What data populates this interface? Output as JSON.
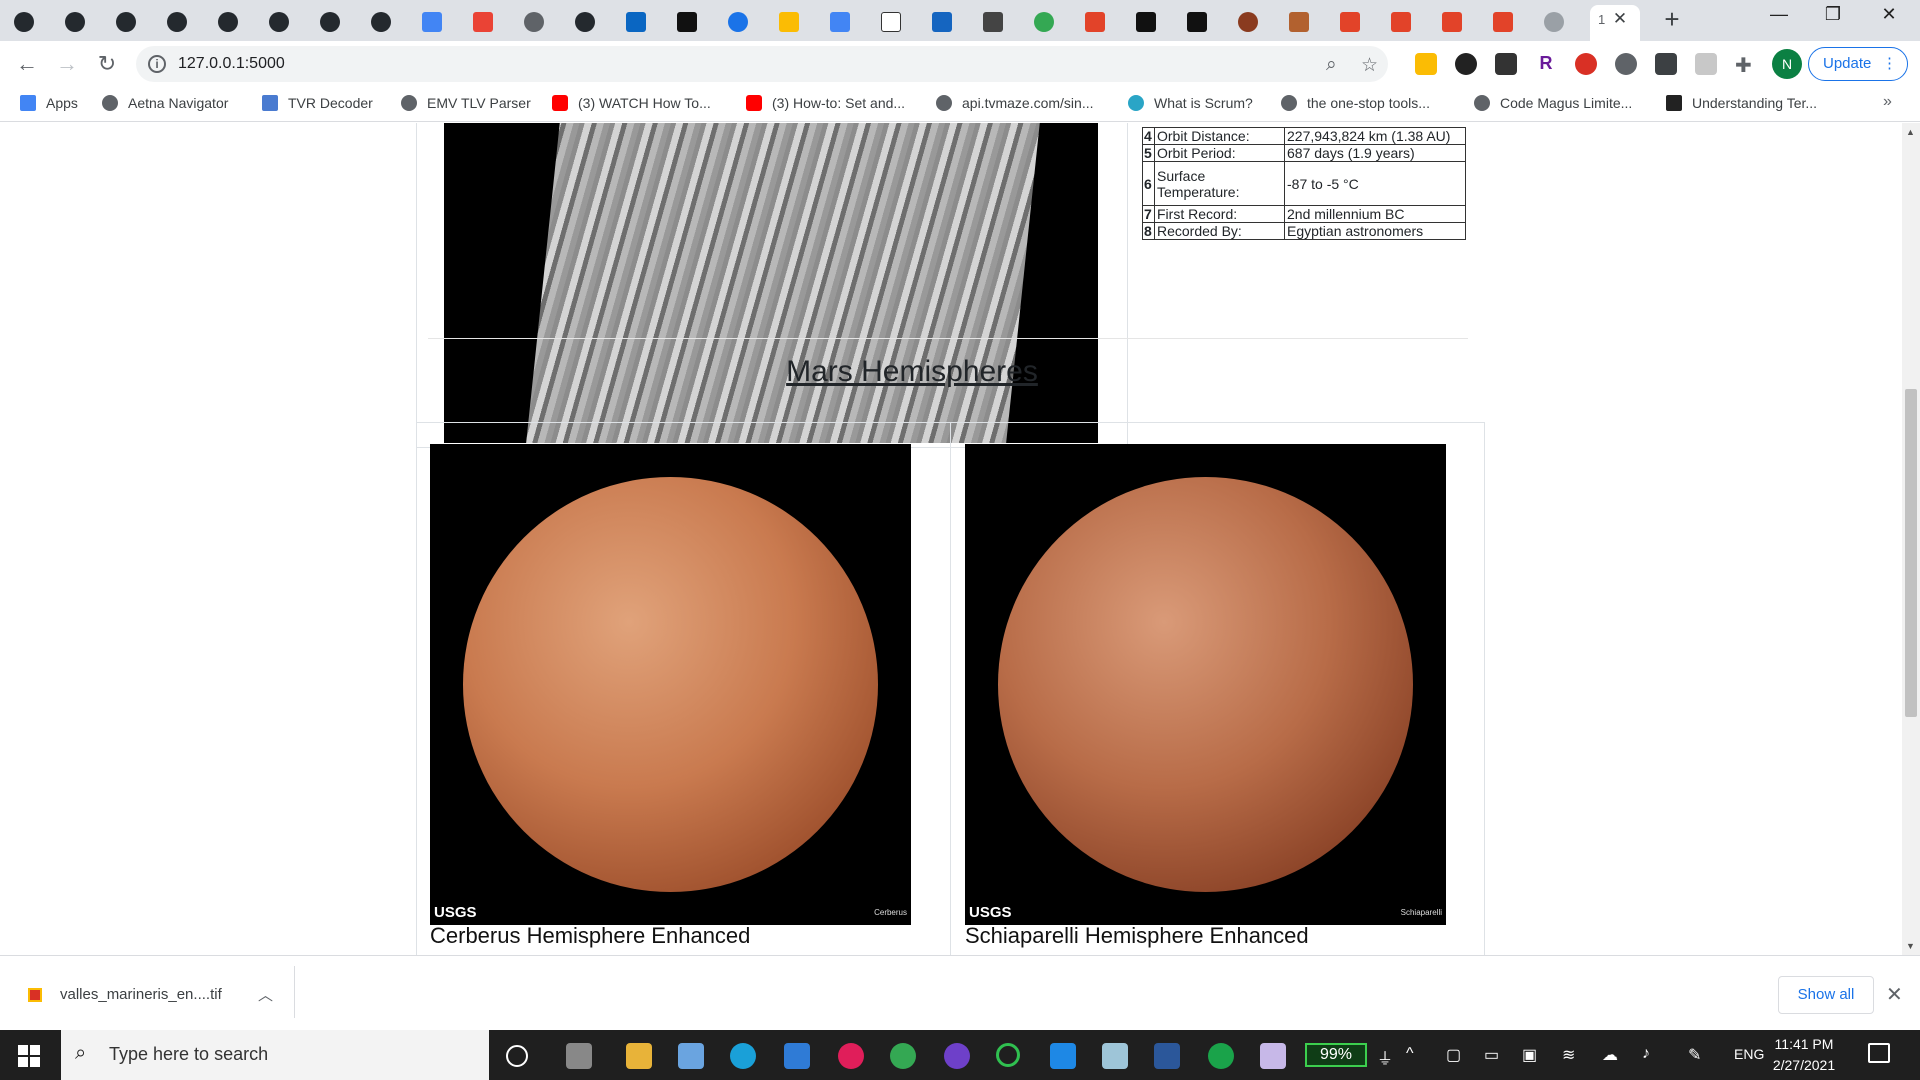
{
  "browser": {
    "active_tab_label": "1",
    "url": "127.0.0.1:5000",
    "update_label": "Update",
    "profile_initial": "N"
  },
  "bookmarks": [
    {
      "label": "Apps"
    },
    {
      "label": "Aetna Navigator"
    },
    {
      "label": "TVR Decoder"
    },
    {
      "label": "EMV TLV Parser"
    },
    {
      "label": "(3) WATCH How To..."
    },
    {
      "label": "(3) How-to: Set and..."
    },
    {
      "label": "api.tvmaze.com/sin..."
    },
    {
      "label": "What is Scrum?"
    },
    {
      "label": "the one-stop tools..."
    },
    {
      "label": "Code Magus Limite..."
    },
    {
      "label": "Understanding Ter..."
    }
  ],
  "facts": [
    {
      "n": "4",
      "key": "Orbit Distance:",
      "value": "227,943,824 km (1.38 AU)"
    },
    {
      "n": "5",
      "key": "Orbit Period:",
      "value": "687 days (1.9 years)"
    },
    {
      "n": "6",
      "key": "Surface Temperature:",
      "value": "-87 to -5 °C"
    },
    {
      "n": "7",
      "key": "First Record:",
      "value": "2nd millennium BC"
    },
    {
      "n": "8",
      "key": "Recorded By:",
      "value": "Egyptian astronomers"
    }
  ],
  "hemispheres": {
    "title": "Mars Hemispheres",
    "items": [
      {
        "caption": "Cerberus Hemisphere Enhanced",
        "img_label": "Cerberus",
        "credit": "USGS"
      },
      {
        "caption": "Schiaparelli Hemisphere Enhanced",
        "img_label": "Schiaparelli",
        "credit": "USGS"
      }
    ]
  },
  "download": {
    "filename": "valles_marineris_en....tif",
    "show_all": "Show all"
  },
  "taskbar": {
    "search_placeholder": "Type here to search",
    "battery": "99%",
    "language": "ENG",
    "time": "11:41 PM",
    "date": "2/27/2021"
  }
}
